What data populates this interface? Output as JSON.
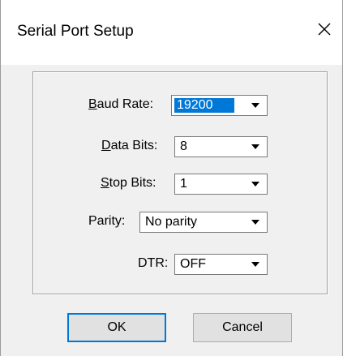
{
  "window": {
    "title": "Serial Port Setup",
    "close_icon": "close-icon"
  },
  "fields": {
    "baud_rate": {
      "label_accel": "B",
      "label_rest": "aud Rate:",
      "value": "19200",
      "selected": true
    },
    "data_bits": {
      "label_accel": "D",
      "label_rest": "ata Bits:",
      "value": "8"
    },
    "stop_bits": {
      "label_accel": "S",
      "label_rest": "top Bits:",
      "value": "1"
    },
    "parity": {
      "label": "Parity:",
      "value": "No parity"
    },
    "dtr": {
      "label": "DTR:",
      "value": "OFF"
    }
  },
  "buttons": {
    "ok": "OK",
    "cancel": "Cancel"
  },
  "colors": {
    "selection": "#0078d7",
    "dialog_bg": "#f0f0f0",
    "title_bg": "#ffffff"
  }
}
